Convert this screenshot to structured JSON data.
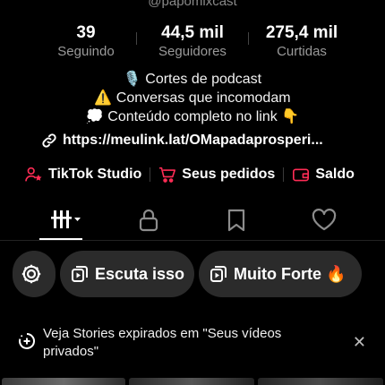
{
  "profile": {
    "handle": "@papomixcast"
  },
  "stats": [
    {
      "value": "39",
      "label": "Seguindo"
    },
    {
      "value": "44,5 mil",
      "label": "Seguidores"
    },
    {
      "value": "275,4 mil",
      "label": "Curtidas"
    }
  ],
  "bio": {
    "line1": "🎙️ Cortes de podcast",
    "line2": "⚠️ Conversas que incomodam",
    "line3": "💭 Conteúdo completo no link 👇",
    "link": "https://meulink.lat/OMapadaprosperi..."
  },
  "quick_links": {
    "studio": "TikTok Studio",
    "orders": "Seus pedidos",
    "balance": "Saldo"
  },
  "colors": {
    "accent_red": "#fe2c55",
    "background": "#000000",
    "chip_bg": "#2b2b2b"
  },
  "tabs": [
    {
      "icon": "grid-icon",
      "active": true
    },
    {
      "icon": "lock-icon",
      "active": false
    },
    {
      "icon": "bookmark-icon",
      "active": false
    },
    {
      "icon": "heart-icon",
      "active": false
    }
  ],
  "chips": {
    "settings_icon": "gear-icon",
    "chip1": "Escuta isso",
    "chip2": "Muito Forte 🔥"
  },
  "banner": {
    "text": "Veja Stories expirados em \"Seus vídeos privados\"",
    "close": "✕"
  }
}
